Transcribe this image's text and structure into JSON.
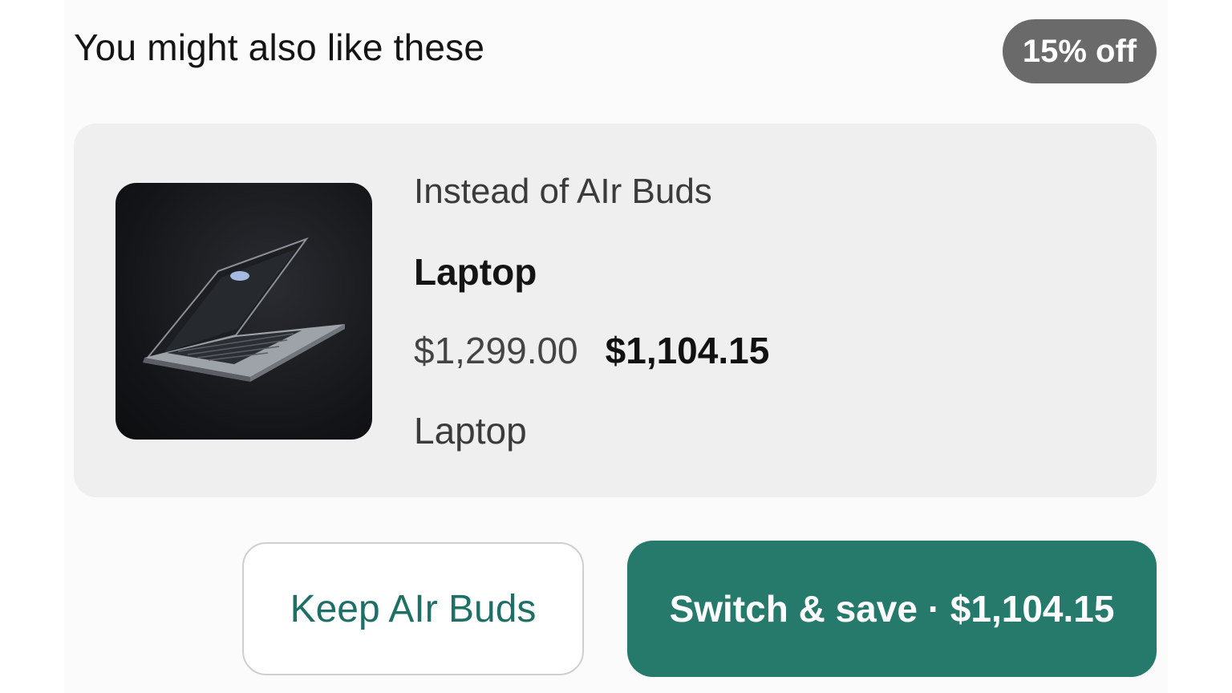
{
  "header": {
    "title": "You might also like these",
    "badge": "15% off"
  },
  "recommendation": {
    "image_icon": "laptop-image",
    "instead_of": "Instead of AIr Buds",
    "name": "Laptop",
    "original_price": "$1,299.00",
    "sale_price": "$1,104.15",
    "category": "Laptop"
  },
  "actions": {
    "keep_label": "Keep AIr Buds",
    "switch_label": "Switch & save · $1,104.15"
  },
  "colors": {
    "accent": "#257a6c",
    "badge": "#6a6a6a",
    "card": "#efefef"
  }
}
